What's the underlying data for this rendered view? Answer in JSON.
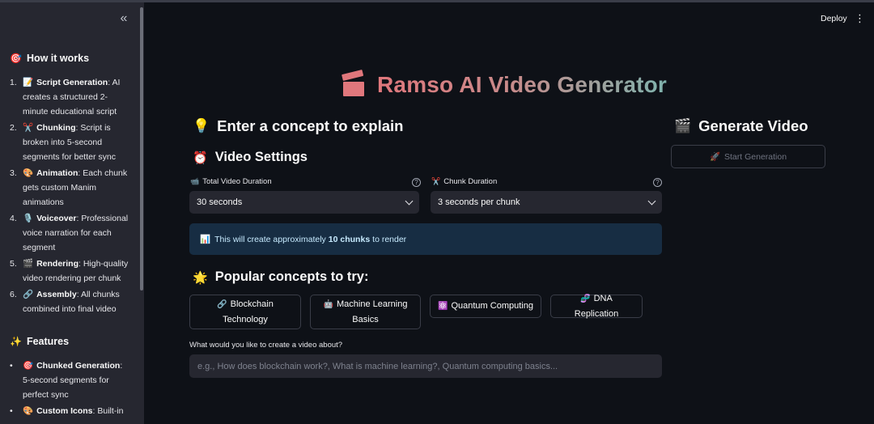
{
  "header": {
    "deploy_label": "Deploy",
    "menu_icon": "⋮"
  },
  "sidebar": {
    "collapse_icon": "«",
    "how_it_works": {
      "emoji": "🎯",
      "title": "How it works",
      "items": [
        {
          "num": "1.",
          "emoji": "📝",
          "bold": "Script Generation",
          "text": ": AI creates a structured 2-minute educational script"
        },
        {
          "num": "2.",
          "emoji": "✂️",
          "bold": "Chunking",
          "text": ": Script is broken into 5-second segments for better sync"
        },
        {
          "num": "3.",
          "emoji": "🎨",
          "bold": "Animation",
          "text": ": Each chunk gets custom Manim animations"
        },
        {
          "num": "4.",
          "emoji": "🎙️",
          "bold": "Voiceover",
          "text": ": Professional voice narration for each segment"
        },
        {
          "num": "5.",
          "emoji": "🎬",
          "bold": "Rendering",
          "text": ": High-quality video rendering per chunk"
        },
        {
          "num": "6.",
          "emoji": "🔗",
          "bold": "Assembly",
          "text": ": All chunks combined into final video"
        }
      ]
    },
    "features": {
      "emoji": "✨",
      "title": "Features",
      "items": [
        {
          "num": "•",
          "emoji": "🎯",
          "bold": "Chunked Generation",
          "text": ": 5-second segments for perfect sync"
        },
        {
          "num": "•",
          "emoji": "🎨",
          "bold": "Custom Icons",
          "text": ": Built-in"
        }
      ]
    }
  },
  "main": {
    "title": "Ramso AI Video Generator",
    "concept_heading": {
      "emoji": "💡",
      "text": "Enter a concept to explain"
    },
    "generate_heading": {
      "emoji": "🎬",
      "text": "Generate Video"
    },
    "start_button": {
      "emoji": "🚀",
      "label": "Start Generation"
    },
    "settings_heading": {
      "emoji": "⏰",
      "text": "Video Settings"
    },
    "total_duration": {
      "emoji": "📹",
      "label": "Total Video Duration",
      "value": "30 seconds"
    },
    "chunk_duration": {
      "emoji": "✂️",
      "label": "Chunk Duration",
      "value": "3 seconds per chunk"
    },
    "info": {
      "emoji": "📊",
      "prefix": "This will create approximately",
      "bold": "10 chunks",
      "suffix": "to render"
    },
    "popular_heading": {
      "emoji": "🌟",
      "text": "Popular concepts to try:"
    },
    "chips": [
      {
        "emoji": "🔗",
        "label": "Blockchain Technology"
      },
      {
        "emoji": "🤖",
        "label": "Machine Learning Basics"
      },
      {
        "emoji": "⚛️",
        "label": "Quantum Computing"
      },
      {
        "emoji": "🧬",
        "label": "DNA Replication"
      }
    ],
    "prompt": {
      "label": "What would you like to create a video about?",
      "placeholder": "e.g., How does blockchain work?, What is machine learning?, Quantum computing basics..."
    }
  }
}
